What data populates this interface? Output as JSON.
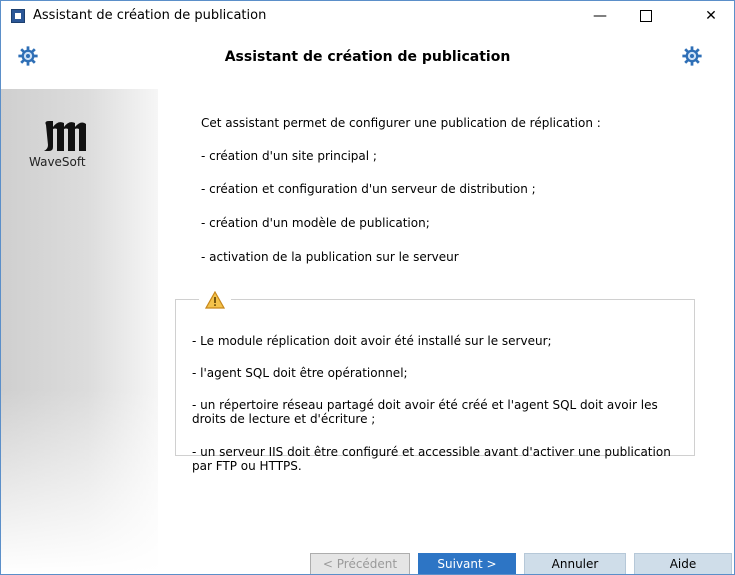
{
  "window": {
    "title": "Assistant de création de publication",
    "minimize_symbol": "—",
    "close_symbol": "✕"
  },
  "header": {
    "title": "Assistant de création de publication"
  },
  "sidebar": {
    "logo_text": "WaveSoft"
  },
  "intro": {
    "lines": [
      "Cet assistant permet de configurer une publication de réplication :",
      "- création d'un site principal ;",
      "- création et configuration d'un serveur de distribution ;",
      "- création d'un modèle de publication;",
      "- activation de la publication sur le serveur"
    ]
  },
  "warnings": {
    "items": [
      "- Le module réplication doit avoir été installé sur le serveur;",
      "- l'agent SQL doit être opérationnel;",
      "- un répertoire réseau partagé doit avoir été créé et l'agent SQL doit avoir les droits de lecture et d'écriture ;",
      "- un serveur IIS doit être configuré et accessible avant d'activer une publication par FTP ou HTTPS."
    ]
  },
  "footer": {
    "prev_label": "< Précédent",
    "next_label": "Suivant >",
    "cancel_label": "Annuler",
    "help_label": "Aide"
  },
  "colors": {
    "accent": "#2d75c5",
    "secondary_button": "#cfdde9",
    "warning": "#e8a33a"
  }
}
